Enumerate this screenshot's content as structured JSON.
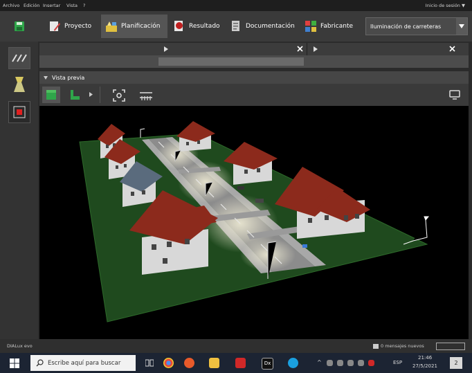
{
  "menu": {
    "items": [
      "Archivo",
      "Edición",
      "Insertar",
      "Vista",
      "?"
    ],
    "login": "Inicio de sesión ▼"
  },
  "toolbar": {
    "tabs": [
      {
        "label": "Proyecto",
        "icon": "project-icon",
        "color": "#d04040"
      },
      {
        "label": "Planificación",
        "icon": "planning-icon",
        "color": "#e0c040"
      },
      {
        "label": "Resultado",
        "icon": "result-icon",
        "color": "#c02020"
      },
      {
        "label": "Documentación",
        "icon": "documentation-icon",
        "color": "#cccccc"
      },
      {
        "label": "Fabricante",
        "icon": "manufacturer-icon",
        "color": "#4080d0"
      }
    ],
    "active_tab": "Planificación",
    "project_selector": "Iluminación de carreteras"
  },
  "panels": {
    "preview_title": "Vista previa"
  },
  "status": {
    "app_label": "DIALux evo",
    "messages": "0 mensajes nuevos"
  },
  "taskbar": {
    "search_placeholder": "Escribe aquí para buscar",
    "language": "ESP",
    "time": "21:46",
    "date": "27/5/2021",
    "notification_count": "2"
  },
  "colors": {
    "accent_green": "#2fa64a",
    "toolbar_bg": "#3a3a3a",
    "viewport_bg": "#000000"
  }
}
